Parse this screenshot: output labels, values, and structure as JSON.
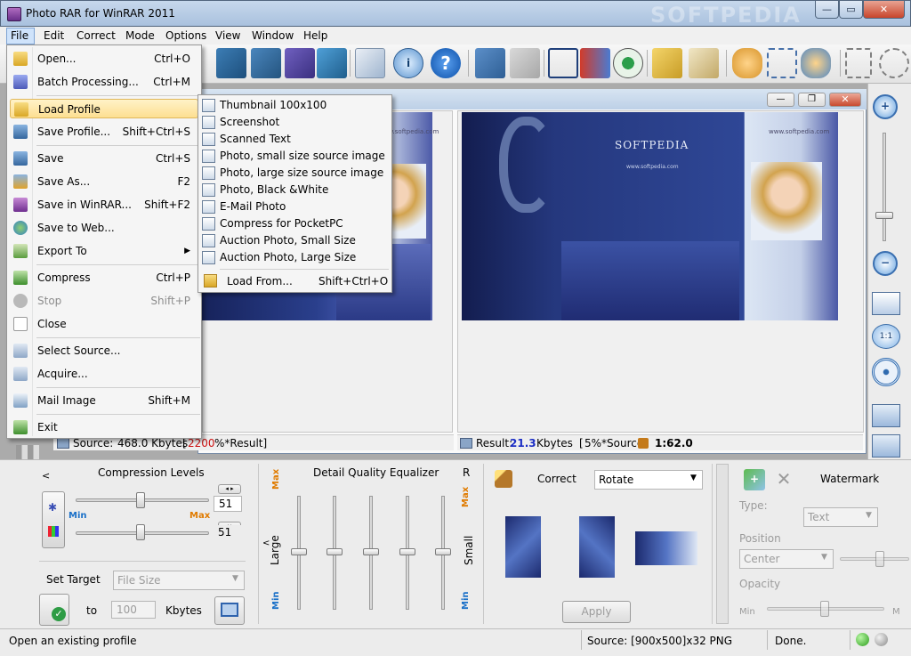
{
  "window": {
    "title": "Photo RAR for WinRAR 2011",
    "watermark": "SOFTPEDIA"
  },
  "menubar": [
    "File",
    "Edit",
    "Correct",
    "Mode",
    "Options",
    "View",
    "Window",
    "Help"
  ],
  "file_menu": {
    "items": [
      {
        "label": "Open...",
        "shortcut": "Ctrl+O",
        "icon": "folder-open-icon"
      },
      {
        "label": "Batch Processing...",
        "shortcut": "Ctrl+M",
        "icon": "batch-icon"
      },
      {
        "label": "Load Profile",
        "shortcut": "",
        "icon": "load-profile-icon"
      },
      {
        "label": "Save Profile...",
        "shortcut": "Shift+Ctrl+S",
        "icon": "save-profile-icon"
      },
      {
        "label": "Save",
        "shortcut": "Ctrl+S",
        "icon": "save-icon"
      },
      {
        "label": "Save As...",
        "shortcut": "F2",
        "icon": "save-as-icon"
      },
      {
        "label": "Save in WinRAR...",
        "shortcut": "Shift+F2",
        "icon": "winrar-icon"
      },
      {
        "label": "Save to Web...",
        "shortcut": "",
        "icon": "web-icon"
      },
      {
        "label": "Export To",
        "shortcut": "",
        "icon": "export-icon"
      },
      {
        "label": "Compress",
        "shortcut": "Ctrl+P",
        "icon": "compress-icon"
      },
      {
        "label": "Stop",
        "shortcut": "Shift+P",
        "icon": "stop-icon"
      },
      {
        "label": "Close",
        "shortcut": "",
        "icon": "close-doc-icon"
      },
      {
        "label": "Select Source...",
        "shortcut": "",
        "icon": "select-source-icon"
      },
      {
        "label": "Acquire...",
        "shortcut": "",
        "icon": "acquire-icon"
      },
      {
        "label": "Mail Image",
        "shortcut": "Shift+M",
        "icon": "mail-icon"
      },
      {
        "label": "Exit",
        "shortcut": "",
        "icon": "exit-icon"
      }
    ]
  },
  "profile_submenu": {
    "items": [
      "Thumbnail 100x100",
      "Screenshot",
      "Scanned Text",
      "Photo, small size source image",
      "Photo, large size source image",
      "Photo, Black &White",
      "E-Mail Photo",
      "Compress for PocketPC",
      "Auction Photo, Small Size",
      "Auction Photo, Large Size"
    ],
    "load_from": {
      "label": "Load From...",
      "shortcut": "Shift+Ctrl+O"
    }
  },
  "source_status": {
    "label": "Source:",
    "size": "468.0 Kbytes",
    "pct": "2200",
    "suffix": "%*Result]"
  },
  "result_status": {
    "label": "Result:",
    "size": "21.3",
    "unit": "Kbytes",
    "pct": "5%*Source]",
    "ratio": "1:62.0"
  },
  "image": {
    "brand": "SOFTPEDIA",
    "url": "www.softpedia.com",
    "side_text": "www.softpedia.com"
  },
  "compression": {
    "title": "Compression Levels",
    "lt": "<",
    "min": "Min",
    "max": "Max",
    "value1": "51",
    "value2": "51",
    "level1": 0.5,
    "level2": 0.5
  },
  "target": {
    "label": "Set Target",
    "type": "File Size",
    "to": "to",
    "value": "100",
    "unit": "Kbytes"
  },
  "equalizer": {
    "title": "Detail Quality Equalizer",
    "r": "R",
    "max": "Max",
    "min": "Min",
    "large": "Large",
    "small": "Small",
    "lt": "<",
    "bands": 5
  },
  "correct": {
    "label": "Correct",
    "action": "Rotate",
    "apply": "Apply"
  },
  "watermark": {
    "label": "Watermark",
    "type_label": "Type:",
    "type_value": "Text",
    "position_label": "Position",
    "position_value": "Center",
    "opacity_label": "Opacity",
    "min": "Min",
    "m": "M"
  },
  "statusbar": {
    "hint": "Open an existing profile",
    "source": "Source: [900x500]x32 PNG",
    "done": "Done."
  }
}
